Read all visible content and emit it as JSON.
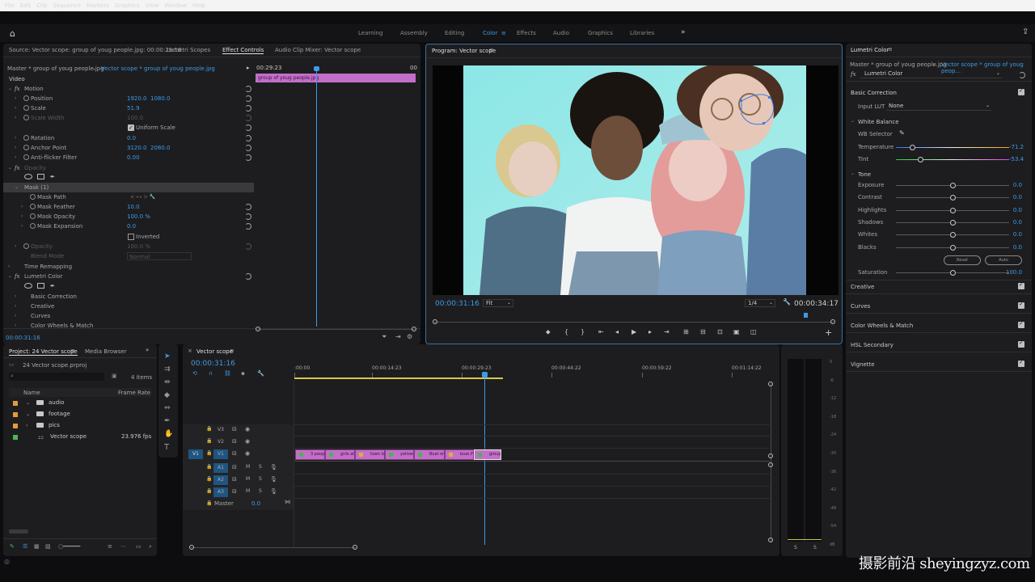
{
  "menu": [
    "File",
    "Edit",
    "Clip",
    "Sequence",
    "Markers",
    "Graphics",
    "View",
    "Window",
    "Help"
  ],
  "workspaces": [
    "Learning",
    "Assembly",
    "Editing",
    "Color",
    "Effects",
    "Audio",
    "Graphics",
    "Libraries"
  ],
  "active_workspace": "Color",
  "source_panel": {
    "tabs": [
      "Source: Vector scope: group of youg people.jpg: 00:00:29:18",
      "Lumetri Scopes",
      "Effect Controls",
      "Audio Clip Mixer: Vector scope"
    ],
    "active_tab": "Effect Controls",
    "master_label": "Master * group of youg people.jpg",
    "seq_label": "Vector scope * group of youg people.jpg",
    "timecode_head": "00:29:23",
    "timecode_end": "00",
    "clip_name": "group of youg people.jpg",
    "section_video": "Video",
    "bottom_timecode": "00:00:31:16",
    "motion": {
      "label": "Motion",
      "position_label": "Position",
      "position_x": "1920.0",
      "position_y": "1080.0",
      "scale_label": "Scale",
      "scale": "51.9",
      "scale_width_label": "Scale Width",
      "scale_width": "100.0",
      "uniform_scale": "Uniform Scale",
      "rotation_label": "Rotation",
      "rotation": "0.0",
      "anchor_label": "Anchor Point",
      "anchor_x": "3120.0",
      "anchor_y": "2080.0",
      "antiflicker_label": "Anti-flicker Filter",
      "antiflicker": "0.00"
    },
    "opacity": {
      "label": "Opacity",
      "mask_label": "Mask (1)",
      "mask_path": "Mask Path",
      "mask_feather_label": "Mask Feather",
      "mask_feather": "10.0",
      "mask_opacity_label": "Mask Opacity",
      "mask_opacity": "100.0 %",
      "mask_expansion_label": "Mask Expansion",
      "mask_expansion": "0.0",
      "inverted": "Inverted",
      "opacity_label": "Opacity",
      "opacity_value": "100.0 %",
      "blend_label": "Blend Mode",
      "blend_value": "Normal"
    },
    "time_remapping": "Time Remapping",
    "lumetri": {
      "label": "Lumetri Color",
      "items": [
        "Basic Correction",
        "Creative",
        "Curves",
        "Color Wheels & Match"
      ]
    }
  },
  "program": {
    "title": "Program: Vector scope",
    "timecode": "00:00:31:16",
    "fit": "Fit",
    "resolution": "1/4",
    "duration": "00:00:34:17",
    "playhead_fraction": 0.93
  },
  "lumetri_panel": {
    "title": "Lumetri Color",
    "master_label": "Master * group of youg people.jpg",
    "seq_label": "Vector scope * group of youg peop...",
    "fx_label": "Lumetri Color",
    "basic_correction": "Basic Correction",
    "input_lut_label": "Input LUT",
    "input_lut": "None",
    "white_balance": "White Balance",
    "wb_selector": "WB Selector",
    "temperature_label": "Temperature",
    "temperature": "-71.2",
    "tint_label": "Tint",
    "tint": "-53.4",
    "tone": "Tone",
    "tone_rows": [
      {
        "label": "Exposure",
        "value": "0.0"
      },
      {
        "label": "Contrast",
        "value": "0.0"
      },
      {
        "label": "Highlights",
        "value": "0.0"
      },
      {
        "label": "Shadows",
        "value": "0.0"
      },
      {
        "label": "Whites",
        "value": "0.0"
      },
      {
        "label": "Blacks",
        "value": "0.0"
      }
    ],
    "reset_btn": "Reset",
    "auto_btn": "Auto",
    "saturation_label": "Saturation",
    "saturation": "100.0",
    "sections": [
      "Creative",
      "Curves",
      "Color Wheels & Match",
      "HSL Secondary",
      "Vignette"
    ]
  },
  "project": {
    "tab": "Project: 24 Vector scope",
    "tab2": "Media Browser",
    "file": "24 Vector scope.prproj",
    "count": "4 items",
    "col_name": "Name",
    "col_rate": "Frame Rate",
    "items": [
      {
        "name": "audio",
        "color": "#e39b3c",
        "type": "folder"
      },
      {
        "name": "footage",
        "color": "#e39b3c",
        "type": "folder"
      },
      {
        "name": "pics",
        "color": "#e39b3c",
        "type": "folder"
      },
      {
        "name": "Vector scope",
        "color": "#4fb75b",
        "type": "sequence",
        "rate": "23.976 fps"
      }
    ]
  },
  "timeline": {
    "tab": "Vector scope",
    "timecode": "00:00:31:16",
    "ruler": [
      ":00:00",
      "00:00:14:23",
      "00:00:29:23",
      "00:00:44:22",
      "00:00:59:22",
      "00:01:14:22"
    ],
    "tracks_video": [
      "V3",
      "V2",
      "V1"
    ],
    "tracks_audio": [
      "A1",
      "A2",
      "A3"
    ],
    "source_v": "V1",
    "source_a": "A1",
    "master_label": "Master",
    "master_value": "0.0",
    "clips": [
      "3 peopl",
      "girls at",
      "town b",
      "yellow",
      "Boat on",
      "boat.P",
      "group"
    ]
  },
  "meter_labels": [
    "0",
    "-6",
    "-12",
    "-18",
    "-24",
    "-30",
    "-36",
    "-42",
    "-48",
    "-54",
    "dB"
  ],
  "meter_s": [
    "S",
    "S"
  ],
  "watermark": "摄影前沿 sheyingzyz.com",
  "colors": {
    "accent": "#3d9be9",
    "clip": "#c36ec8",
    "playhead": "#3d9be9"
  }
}
